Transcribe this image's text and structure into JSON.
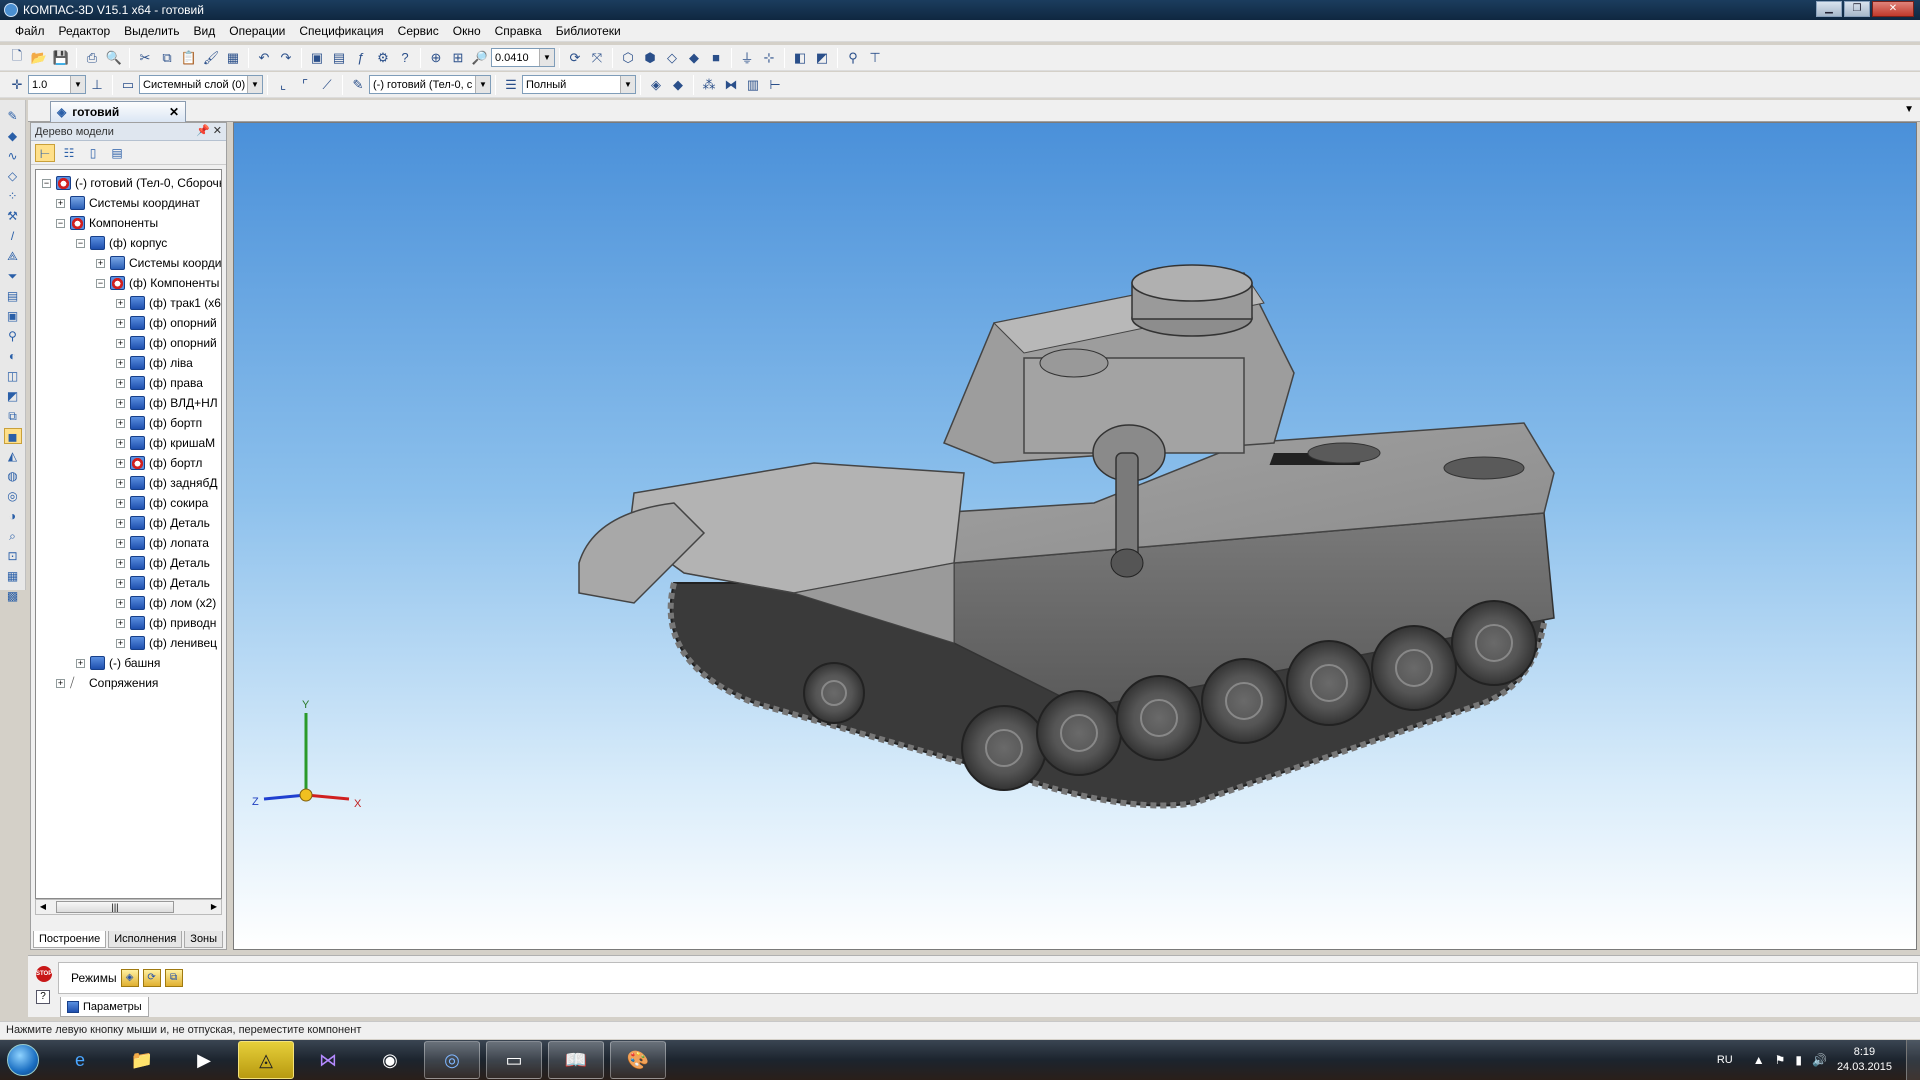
{
  "window": {
    "title": "КОМПАС-3D V15.1 x64 - готовий"
  },
  "menu": [
    "Файл",
    "Редактор",
    "Выделить",
    "Вид",
    "Операции",
    "Спецификация",
    "Сервис",
    "Окно",
    "Справка",
    "Библиотеки"
  ],
  "toolbar1": {
    "zoom_value": "0.0410"
  },
  "toolbar2": {
    "step_value": "1.0",
    "layer": "Системный слой (0)",
    "body_filter": "(-) готовий (Тел-0, с",
    "display_mode": "Полный"
  },
  "doc_tab": {
    "label": "готовий"
  },
  "tree_panel": {
    "title": "Дерево модели",
    "nodes": [
      {
        "label": "(-) готовий (Тел-0, Сборочнь",
        "icon": "assembly-error-icon"
      },
      {
        "label": "Системы координат",
        "icon": "coord-system-icon"
      },
      {
        "label": "Компоненты",
        "icon": "components-error-icon"
      },
      {
        "label": "(ф) корпус",
        "icon": "subassembly-icon"
      },
      {
        "label": "Системы коорди",
        "icon": "coord-system-icon"
      },
      {
        "label": "(ф) Компоненты",
        "icon": "components-error-icon"
      },
      {
        "label": "(ф) трак1 (х6",
        "icon": "part-icon"
      },
      {
        "label": "(ф) опорний",
        "icon": "part-icon"
      },
      {
        "label": "(ф) опорний",
        "icon": "part-icon"
      },
      {
        "label": "(ф) ліва",
        "icon": "part-icon"
      },
      {
        "label": "(ф) права",
        "icon": "part-icon"
      },
      {
        "label": "(ф) ВЛД+НЛ",
        "icon": "part-icon"
      },
      {
        "label": "(ф) бортп",
        "icon": "part-icon"
      },
      {
        "label": "(ф) кришаМ",
        "icon": "part-icon"
      },
      {
        "label": "(ф) бортл",
        "icon": "part-error-icon"
      },
      {
        "label": "(ф) заднябД",
        "icon": "part-icon"
      },
      {
        "label": "(ф) сокира",
        "icon": "part-icon"
      },
      {
        "label": "(ф) Деталь",
        "icon": "part-icon"
      },
      {
        "label": "(ф) лопата",
        "icon": "part-icon"
      },
      {
        "label": "(ф) Деталь",
        "icon": "part-icon"
      },
      {
        "label": "(ф) Деталь",
        "icon": "part-icon"
      },
      {
        "label": "(ф) лом (х2)",
        "icon": "part-icon"
      },
      {
        "label": "(ф) приводн",
        "icon": "part-icon"
      },
      {
        "label": "(ф) ленивец",
        "icon": "part-icon"
      },
      {
        "label": "(-) башня",
        "icon": "subassembly-icon"
      },
      {
        "label": "Сопряжения",
        "icon": "mates-icon"
      }
    ],
    "tabs": [
      "Построение",
      "Исполнения",
      "Зоны"
    ]
  },
  "axes": {
    "y": "Y",
    "x": "X",
    "z": "Z"
  },
  "bottom_panel": {
    "modes_label": "Режимы",
    "stop_label": "STOP",
    "params_tab": "Параметры"
  },
  "status": {
    "hint": "Нажмите левую кнопку мыши и, не отпуская, переместите компонент"
  },
  "taskbar": {
    "lang": "RU",
    "time": "8:19",
    "date": "24.03.2015"
  }
}
